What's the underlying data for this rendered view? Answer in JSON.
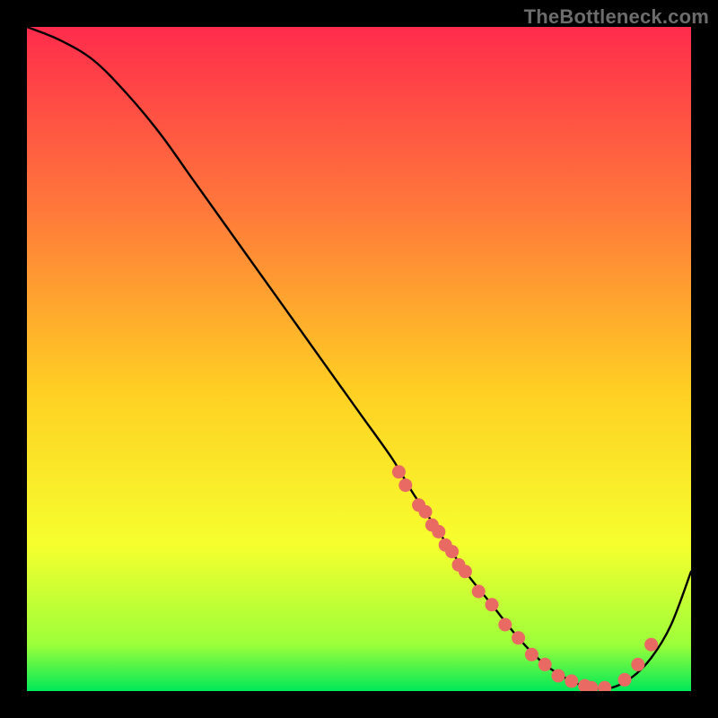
{
  "watermark": "TheBottleneck.com",
  "colors": {
    "background": "#000000",
    "curve": "#000000",
    "marker": "#e86a62",
    "gradient_top": "#ff2c4c",
    "gradient_upper_mid": "#ff7a3a",
    "gradient_mid": "#ffd023",
    "gradient_lower_mid": "#f6ff2e",
    "gradient_low": "#9cff3a",
    "gradient_bottom": "#00e858"
  },
  "chart_data": {
    "type": "line",
    "title": "",
    "xlabel": "",
    "ylabel": "",
    "xlim": [
      0,
      100
    ],
    "ylim": [
      0,
      100
    ],
    "grid": false,
    "legend": false,
    "series": [
      {
        "name": "bottleneck-curve",
        "x": [
          0,
          5,
          10,
          15,
          20,
          25,
          30,
          35,
          40,
          45,
          50,
          55,
          58,
          62,
          66,
          70,
          74,
          78,
          82,
          85,
          88,
          91,
          94,
          97,
          100
        ],
        "y": [
          100,
          98,
          95,
          90,
          84,
          77,
          70,
          63,
          56,
          49,
          42,
          35,
          30,
          24,
          18,
          13,
          8,
          4,
          1.5,
          0.5,
          0.5,
          2,
          5,
          10,
          18
        ]
      }
    ],
    "markers": {
      "name": "sample-points",
      "x": [
        56,
        57,
        59,
        60,
        61,
        62,
        63,
        64,
        65,
        66,
        68,
        70,
        72,
        74,
        76,
        78,
        80,
        82,
        84,
        85,
        87,
        90,
        92,
        94
      ],
      "y": [
        33,
        31,
        28,
        27,
        25,
        24,
        22,
        21,
        19,
        18,
        15,
        13,
        10,
        8,
        5.5,
        4,
        2.3,
        1.5,
        0.8,
        0.5,
        0.5,
        1.7,
        4,
        7
      ]
    }
  }
}
